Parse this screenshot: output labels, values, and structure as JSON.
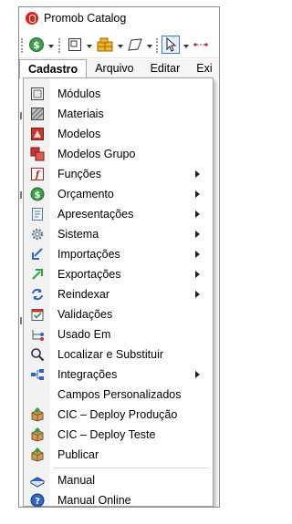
{
  "window": {
    "title": "Promob Catalog"
  },
  "toolbar": {
    "icons": [
      "money-icon",
      "layout-icon",
      "grid-icon",
      "shape-icon",
      "pointer-icon",
      "ruler-icon"
    ]
  },
  "menubar": {
    "tabs": [
      "Cadastro",
      "Arquivo",
      "Editar",
      "Exi"
    ],
    "active": "Cadastro"
  },
  "menu": {
    "items": [
      {
        "label": "Módulos",
        "icon": "modules-icon",
        "submenu": false
      },
      {
        "label": "Materiais",
        "icon": "materials-icon",
        "submenu": false
      },
      {
        "label": "Modelos",
        "icon": "models-icon",
        "submenu": false
      },
      {
        "label": "Modelos Grupo",
        "icon": "models-group-icon",
        "submenu": false
      },
      {
        "label": "Funções",
        "icon": "functions-icon",
        "submenu": true
      },
      {
        "label": "Orçamento",
        "icon": "budget-icon",
        "submenu": true
      },
      {
        "label": "Apresentações",
        "icon": "presentations-icon",
        "submenu": true
      },
      {
        "label": "Sistema",
        "icon": "system-gear-icon",
        "submenu": true
      },
      {
        "label": "Importações",
        "icon": "import-icon",
        "submenu": true
      },
      {
        "label": "Exportações",
        "icon": "export-icon",
        "submenu": true
      },
      {
        "label": "Reindexar",
        "icon": "reindex-icon",
        "submenu": true
      },
      {
        "label": "Validações",
        "icon": "validations-icon",
        "submenu": false
      },
      {
        "label": "Usado Em",
        "icon": "used-in-icon",
        "submenu": false
      },
      {
        "label": "Localizar e Substituir",
        "icon": "find-replace-icon",
        "submenu": false
      },
      {
        "label": "Integrações",
        "icon": "integrations-icon",
        "submenu": true
      },
      {
        "label": "Campos Personalizados",
        "icon": "",
        "submenu": false
      },
      {
        "label": "CIC – Deploy Produção",
        "icon": "package-icon",
        "submenu": false
      },
      {
        "label": "CIC – Deploy Teste",
        "icon": "package-icon",
        "submenu": false
      },
      {
        "label": "Publicar",
        "icon": "package-icon",
        "submenu": false
      },
      {
        "label": "Manual",
        "icon": "book-icon",
        "submenu": false
      },
      {
        "label": "Manual Online",
        "icon": "help-icon",
        "submenu": false
      }
    ]
  }
}
